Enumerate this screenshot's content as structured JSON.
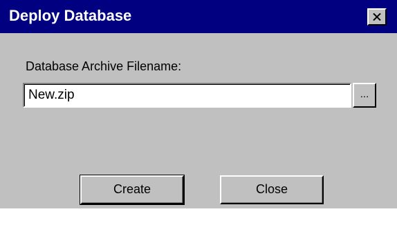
{
  "window": {
    "title": "Deploy Database",
    "close_icon": "close-x-icon"
  },
  "form": {
    "archive_label": "Database Archive Filename:",
    "archive_value": "New.zip",
    "browse_label": "..."
  },
  "buttons": {
    "create_label": "Create",
    "close_label": "Close"
  },
  "colors": {
    "titlebar": "#000080",
    "dialog_face": "#c0c0c0",
    "title_text": "#ffffff"
  }
}
